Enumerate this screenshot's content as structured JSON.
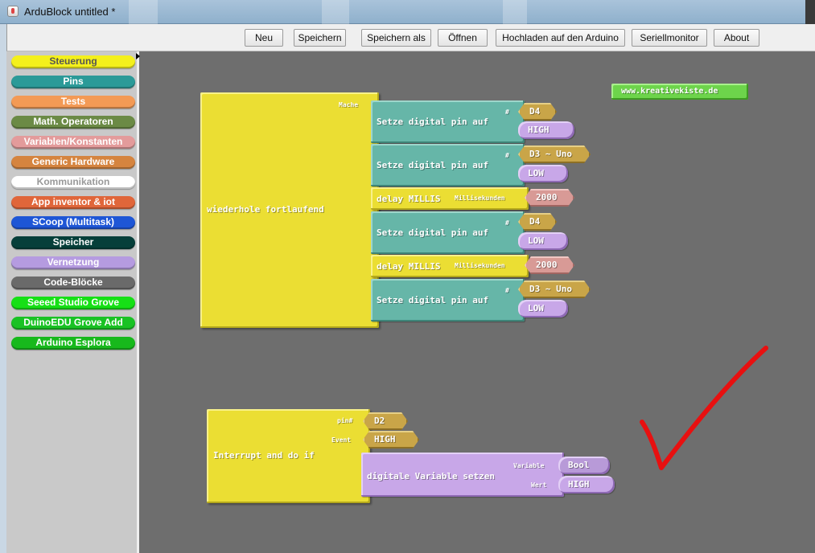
{
  "window": {
    "title": "ArduBlock untitled *"
  },
  "toolbar": {
    "buttons": [
      "Neu",
      "Speichern",
      "Speichern als",
      "Öffnen",
      "Hochladen auf den Arduino",
      "Seriellmonitor",
      "About"
    ]
  },
  "palette": {
    "categories": [
      {
        "label": "Steuerung",
        "color": "#f4f01c"
      },
      {
        "label": "Pins",
        "color": "#2b9a98"
      },
      {
        "label": "Tests",
        "color": "#f39a55"
      },
      {
        "label": "Math. Operatoren",
        "color": "#6b8a45"
      },
      {
        "label": "Variablen/Konstanten",
        "color": "#e39b9b"
      },
      {
        "label": "Generic Hardware",
        "color": "#d5843f"
      },
      {
        "label": "Kommunikation",
        "color": "#ffffff"
      },
      {
        "label": "App inventor & iot",
        "color": "#e0663a"
      },
      {
        "label": "SCoop (Multitask)",
        "color": "#1e56d6"
      },
      {
        "label": "Speicher",
        "color": "#063f3a"
      },
      {
        "label": "Vernetzung",
        "color": "#b59be0"
      },
      {
        "label": "Code-Blöcke",
        "color": "#6a6a6a"
      },
      {
        "label": "Seeed Studio Grove",
        "color": "#16e016"
      },
      {
        "label": "DuinoEDU Grove Add",
        "color": "#19c224"
      },
      {
        "label": "Arduino Esplora",
        "color": "#17b91c"
      }
    ]
  },
  "canvas": {
    "url_block": "www.kreativekiste.de",
    "loop": {
      "label": "wiederhole fortlaufend",
      "socket": "Mache",
      "statements": [
        {
          "type": "pin",
          "label": "Setze digital pin auf",
          "hash": "#",
          "pin": "D4",
          "value": "HIGH"
        },
        {
          "type": "pin",
          "label": "Setze digital pin auf",
          "hash": "#",
          "pin": "D3 ~ Uno",
          "value": "LOW"
        },
        {
          "type": "delay",
          "label": "delay MILLIS",
          "unit": "Millisekunden",
          "value": "2000"
        },
        {
          "type": "pin",
          "label": "Setze digital pin auf",
          "hash": "#",
          "pin": "D4",
          "value": "LOW"
        },
        {
          "type": "delay",
          "label": "delay MILLIS",
          "unit": "Millisekunden",
          "value": "2000"
        },
        {
          "type": "pin",
          "label": "Setze digital pin auf",
          "hash": "#",
          "pin": "D3 ~ Uno",
          "value": "LOW"
        }
      ]
    },
    "interrupt": {
      "label": "Interrupt and do if",
      "pin_label": "pin#",
      "pin": "D2",
      "event_label": "Event",
      "event": "HIGH",
      "setvar": {
        "label": "digitale Variable setzen",
        "var_label": "Variable",
        "var": "Bool",
        "value_label": "Wert",
        "value": "HIGH"
      }
    },
    "annotation_color": "#e81010"
  }
}
